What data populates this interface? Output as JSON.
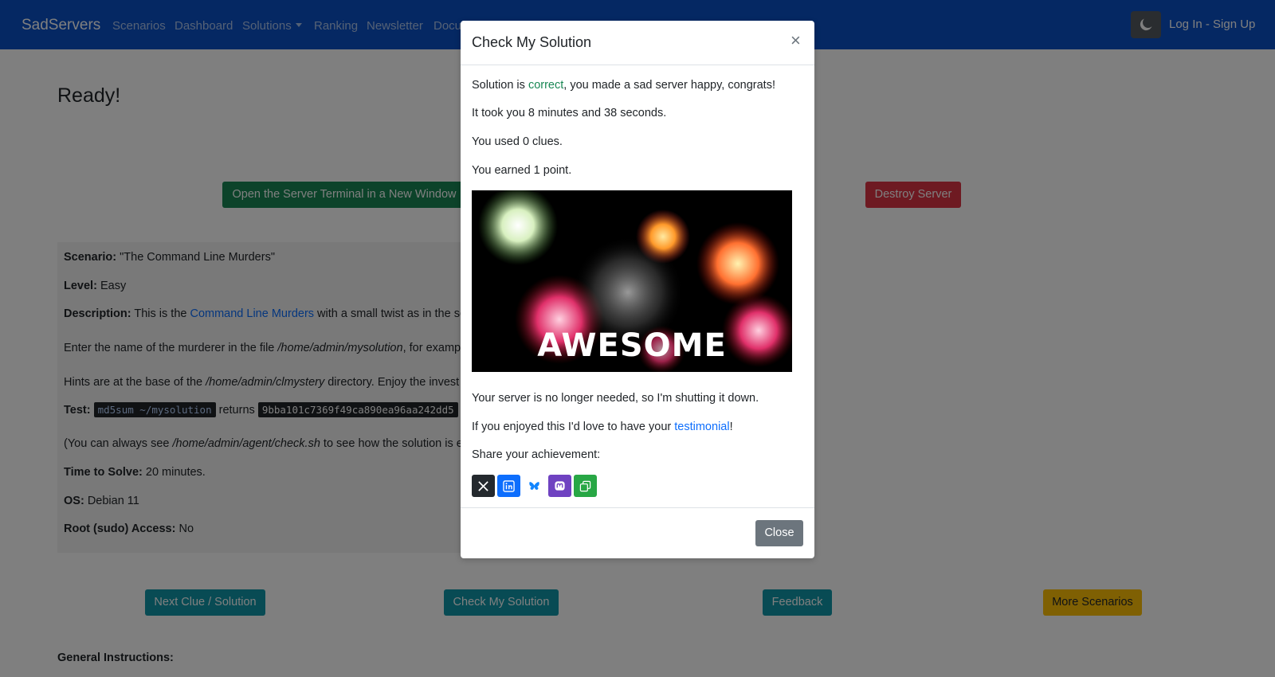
{
  "navbar": {
    "brand": "SadServers",
    "links": [
      "Scenarios",
      "Dashboard",
      "Solutions",
      "Ranking",
      "Newsletter",
      "Docu"
    ],
    "login": "Log In - Sign Up"
  },
  "page": {
    "title": "Ready!",
    "open_terminal": "Open the Server Terminal in a New Window",
    "destroy_server": "Destroy Server",
    "scenario_label": "Scenario:",
    "scenario_value": "\"The Command Line Murders\"",
    "level_label": "Level:",
    "level_value": "Easy",
    "description_label": "Description:",
    "description_pre": "This is the ",
    "description_link": "Command Line Murders",
    "description_post": " with a small twist as in the so",
    "enter_pre": "Enter the name of the murderer in the file ",
    "enter_path": "/home/admin/mysolution",
    "enter_post": ", for examp",
    "hints_pre": "Hints are at the base of the ",
    "hints_path": "/home/admin/clmystery",
    "hints_post": " directory. Enjoy the invest",
    "test_label": "Test:",
    "test_command": "md5sum ~/mysolution",
    "test_returns": "returns",
    "test_hash": "9bba101c7369f49ca890ea96aa242dd5",
    "check_pre": "(You can always see ",
    "check_path": "/home/admin/agent/check.sh",
    "check_post": " to see how the solution is e",
    "time_label": "Time to Solve:",
    "time_value": "20 minutes.",
    "os_label": "OS:",
    "os_value": "Debian 11",
    "root_label": "Root (sudo) Access:",
    "root_value": "No",
    "buttons": {
      "next_clue": "Next Clue / Solution",
      "check": "Check My Solution",
      "feedback": "Feedback",
      "more": "More Scenarios"
    },
    "general_instructions": "General Instructions:"
  },
  "modal": {
    "title": "Check My Solution",
    "close_x": "×",
    "result_pre": "Solution is ",
    "result_word": "correct",
    "result_post": ", you made a sad server happy, congrats!",
    "time_taken": "It took you 8 minutes and 38 seconds.",
    "clues": "You used 0 clues.",
    "points": "You earned 1 point.",
    "gif_caption": "AWESOME",
    "shutdown": "Your server is no longer needed, so I'm shutting it down.",
    "testimonial_pre": "If you enjoyed this I'd love to have your ",
    "testimonial_link": "testimonial",
    "testimonial_post": "!",
    "share_label": "Share your achievement:",
    "share_icons": [
      "x-icon",
      "linkedin-icon",
      "bluesky-icon",
      "mastodon-icon",
      "copy-icon"
    ],
    "close_button": "Close"
  },
  "colors": {
    "navbar": "#0b50c6",
    "success": "#198754",
    "danger": "#dc3545",
    "info": "#1097a8",
    "warning": "#ffc107",
    "secondary": "#6c757d",
    "link": "#0d6efd"
  }
}
